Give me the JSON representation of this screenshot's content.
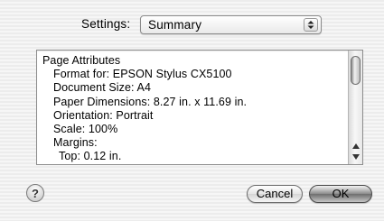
{
  "settings": {
    "label": "Settings:",
    "selected": "Summary"
  },
  "summary": {
    "heading": "Page Attributes",
    "format_for": "Format for:  EPSON Stylus CX5100",
    "document_size": "Document Size:  A4",
    "paper_dimensions": "Paper Dimensions:  8.27 in. x 11.69 in.",
    "orientation": "Orientation:  Portrait",
    "scale": "Scale:  100%",
    "margins": "Margins:",
    "top": "Top:  0.12 in."
  },
  "buttons": {
    "help": "?",
    "cancel": "Cancel",
    "ok": "OK"
  }
}
